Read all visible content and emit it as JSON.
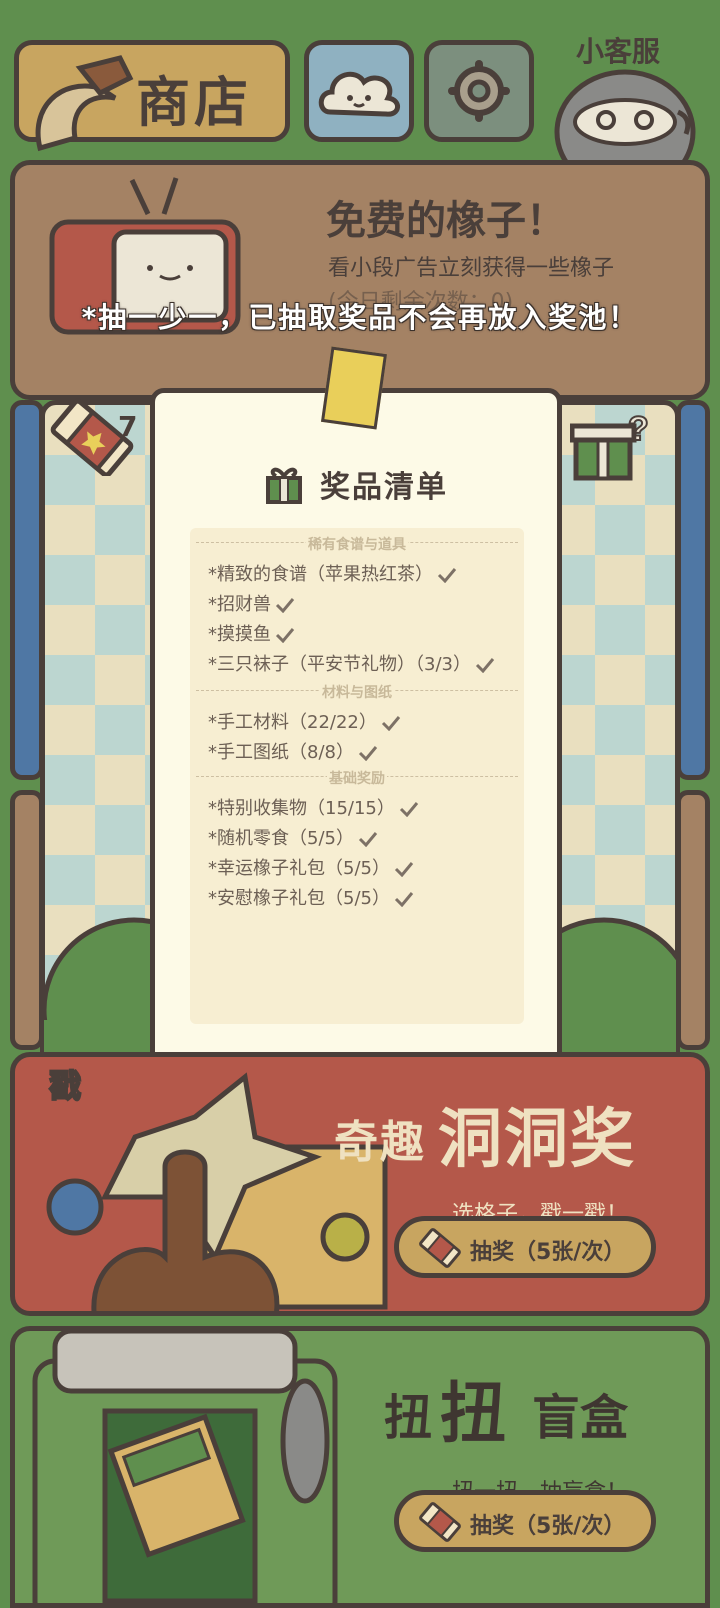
{
  "header": {
    "shop_label": "商店",
    "service_label": "小客服"
  },
  "ad": {
    "title": "免费的橡子！",
    "subtitle": "看小段广告立刻获得一些橡子",
    "remaining": "(今日剩余次数：0)"
  },
  "notice": "*抽一少一，已抽取奖品不会再放入奖池！",
  "ticket_count": "7",
  "prize_list": {
    "title": "奖品清单",
    "sections": [
      {
        "name": "稀有食谱与道具",
        "items": [
          "*精致的食谱（苹果热红茶）",
          "*招财兽",
          "*摸摸鱼",
          "*三只袜子（平安节礼物）（3/3）"
        ]
      },
      {
        "name": "材料与图纸",
        "items": [
          "*手工材料（22/22）",
          "*手工图纸（8/8）"
        ]
      },
      {
        "name": "基础奖励",
        "items": [
          "*特别收集物（15/15）",
          "*随机零食（5/5）",
          "*幸运橡子礼包（5/5）",
          "*安慰橡子礼包（5/5）"
        ]
      }
    ]
  },
  "lottery": {
    "title_a": "奇趣",
    "title_b": "洞洞奖",
    "subtitle": "选格子，戳一戳！",
    "button": "抽奖（5张/次）",
    "poke_text": "戳"
  },
  "blindbox": {
    "title_a": "扭",
    "title_b": "扭",
    "title_c": "盲盒",
    "subtitle": "扭一扭，抽盲盒！",
    "button": "抽奖（5张/次）"
  },
  "colors": {
    "background": "#5f8f4e",
    "outline": "#4a3f3a",
    "paper": "#fdfae7",
    "accent_gold": "#c8a560",
    "lottery_red": "#b4584a"
  }
}
